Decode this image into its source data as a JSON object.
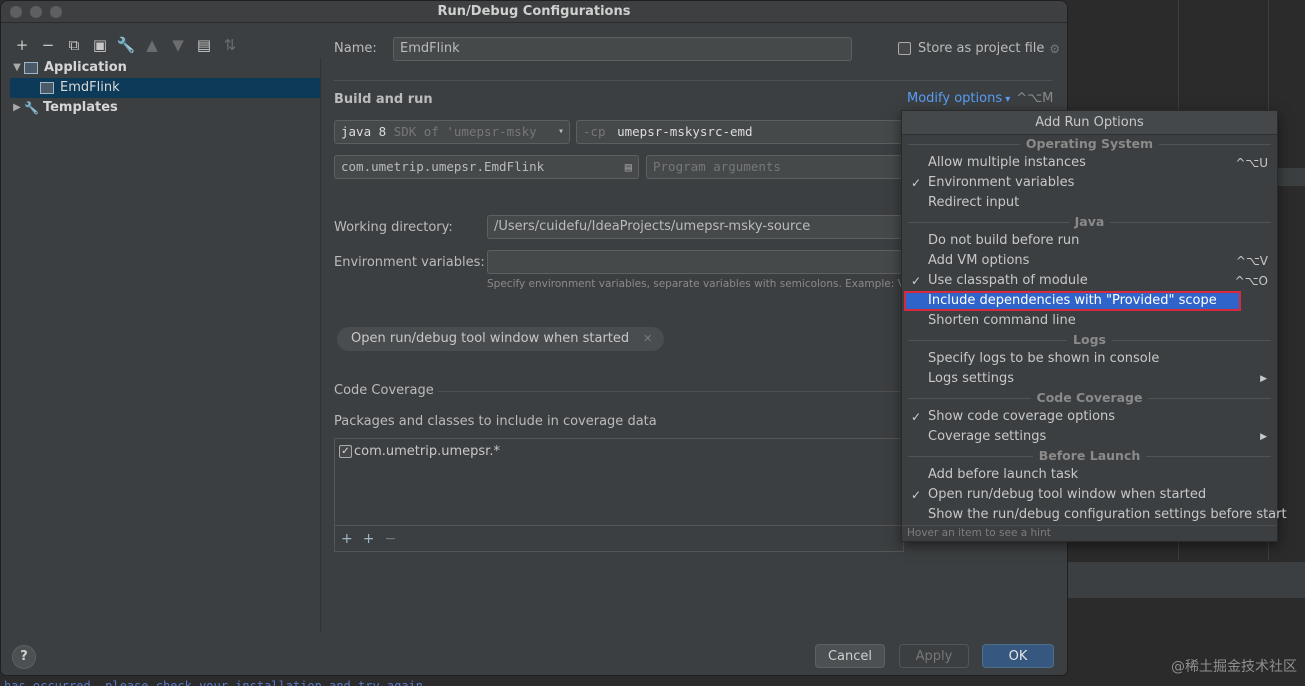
{
  "window": {
    "title": "Run/Debug Configurations"
  },
  "tree": {
    "application": "Application",
    "emdflink": "EmdFlink",
    "templates": "Templates"
  },
  "form": {
    "name_label": "Name:",
    "name_value": "EmdFlink",
    "store_label": "Store as project file",
    "build_run_label": "Build and run",
    "modify_options": "Modify options",
    "modify_shortcut": "^⌥M",
    "jdk_bold": "java 8",
    "jdk_rest": "SDK of 'umepsr-msky",
    "cp_prefix": "-cp",
    "cp_value": "umepsr-mskysrc-emd",
    "main_class": "com.umetrip.umepsr.EmdFlink",
    "program_args_placeholder": "Program arguments",
    "workdir_label": "Working directory:",
    "workdir_value": "/Users/cuidefu/IdeaProjects/umepsr-msky-source",
    "env_label": "Environment variables:",
    "env_hint": "Specify environment variables, separate variables with semicolons. Example: VA",
    "chip_label": "Open run/debug tool window when started",
    "code_coverage_label": "Code Coverage",
    "packages_label": "Packages and classes to include in coverage data",
    "coverage_item": "com.umetrip.umepsr.*"
  },
  "buttons": {
    "cancel": "Cancel",
    "apply": "Apply",
    "ok": "OK"
  },
  "popup": {
    "title": "Add Run Options",
    "hint": "Hover an item to see a hint",
    "groups": {
      "os": "Operating System",
      "java": "Java",
      "logs": "Logs",
      "coverage": "Code Coverage",
      "before": "Before Launch"
    },
    "items": {
      "allow_multiple": "Allow multiple instances",
      "allow_multiple_sc": "^⌥U",
      "env_vars": "Environment variables",
      "redirect_input": "Redirect input",
      "no_build": "Do not build before run",
      "add_vm": "Add VM options",
      "add_vm_sc": "^⌥V",
      "classpath": "Use classpath of module",
      "classpath_sc": "^⌥O",
      "provided": "Include dependencies with \"Provided\" scope",
      "shorten": "Shorten command line",
      "logs_console": "Specify logs to be shown in console",
      "logs_settings": "Logs settings",
      "show_coverage": "Show code coverage options",
      "coverage_settings": "Coverage settings",
      "add_before": "Add before launch task",
      "open_tool": "Open run/debug tool window when started",
      "show_settings": "Show the run/debug configuration settings before start"
    }
  },
  "background": {
    "console_text": "has occurred, please check your installation and try again",
    "watermark": "@稀土掘金技术社区"
  }
}
